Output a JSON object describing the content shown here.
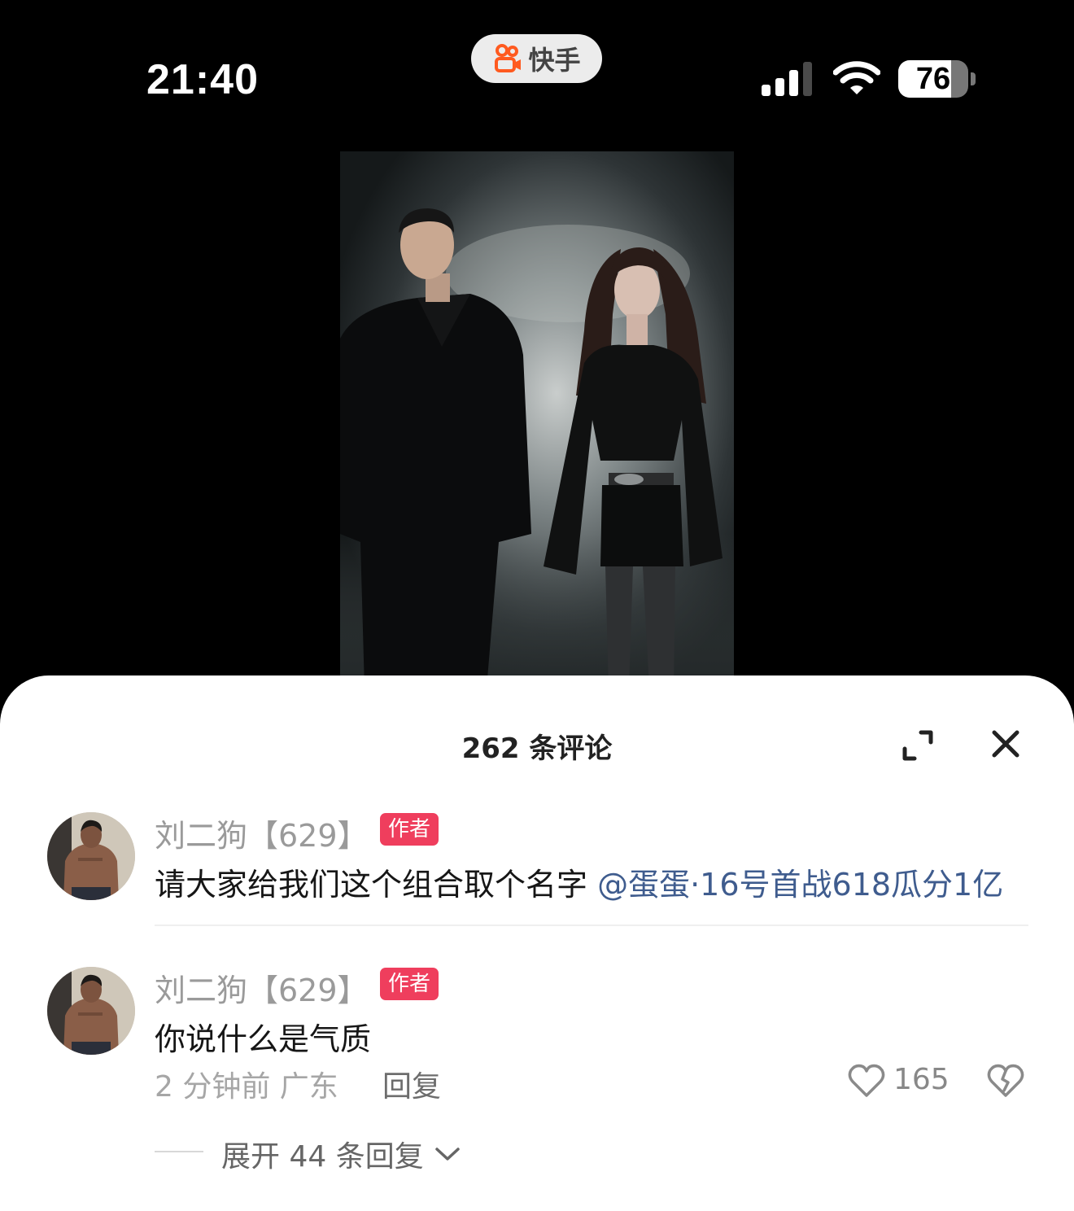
{
  "status_bar": {
    "time": "21:40",
    "app_name": "快手",
    "battery": "76",
    "battery_level": 0.76
  },
  "comments_panel": {
    "title": "262 条评论",
    "comments": [
      {
        "author": "刘二狗【629】",
        "badge": "作者",
        "text": "请大家给我们这个组合取个名字 ",
        "mention": "@蛋蛋·16号首战618瓜分1亿"
      },
      {
        "author": "刘二狗【629】",
        "badge": "作者",
        "text": "你说什么是气质",
        "time_location": "2 分钟前  广东",
        "reply_label": "回复",
        "likes": "165",
        "expand_label": "展开 44 条回复"
      }
    ]
  },
  "icons": {
    "app_logo": "kuaishou-logo-icon",
    "expand": "expand-icon",
    "close": "close-icon",
    "like": "heart-icon",
    "dislike": "broken-heart-icon",
    "chevron": "chevron-down-icon"
  },
  "colors": {
    "author_badge": "#ef3e5d",
    "mention": "#3f5c8e",
    "app_logo": "#ff5a1f"
  }
}
